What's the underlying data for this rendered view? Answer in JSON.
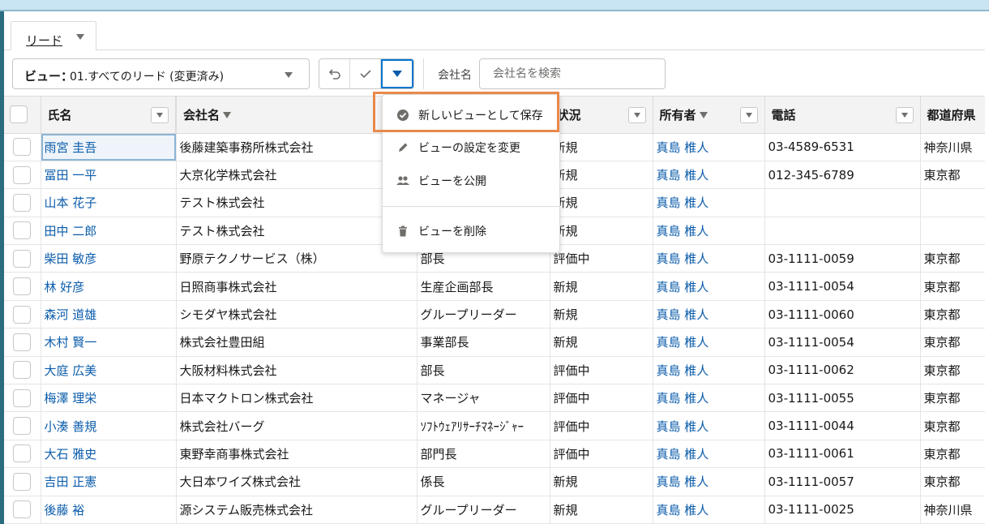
{
  "tab": {
    "label": "リード"
  },
  "view": {
    "prefix": "ビュー：",
    "name": "01.すべてのリード (変更済み)"
  },
  "search": {
    "label": "会社名",
    "placeholder": "会社名を検索"
  },
  "columns": [
    "氏名",
    "会社名",
    "",
    "状況",
    "所有者",
    "電話",
    "都道府県"
  ],
  "dropdown": {
    "items": [
      {
        "label": "新しいビューとして保存",
        "icon": "check-circle-icon"
      },
      {
        "label": "ビューの設定を変更",
        "icon": "pencil-icon"
      },
      {
        "label": "ビューを公開",
        "icon": "people-icon"
      },
      {
        "label": "ビューを削除",
        "icon": "trash-icon"
      }
    ]
  },
  "rows": [
    {
      "name": "雨宮 圭吾",
      "company": "後藤建築事務所株式会社",
      "title": "",
      "status": "新規",
      "owner": "真島 椎人",
      "phone": "03-4589-6531",
      "pref": "神奈川県"
    },
    {
      "name": "冨田 一平",
      "company": "大京化学株式会社",
      "title": "",
      "status": "新規",
      "owner": "真島 椎人",
      "phone": "012-345-6789",
      "pref": "東京都"
    },
    {
      "name": "山本 花子",
      "company": "テスト株式会社",
      "title": "",
      "status": "新規",
      "owner": "真島 椎人",
      "phone": "",
      "pref": ""
    },
    {
      "name": "田中 二郎",
      "company": "テスト株式会社",
      "title": "",
      "status": "新規",
      "owner": "真島 椎人",
      "phone": "",
      "pref": ""
    },
    {
      "name": "柴田 敏彦",
      "company": "野原テクノサービス（株）",
      "title": "部長",
      "status": "評価中",
      "owner": "真島 椎人",
      "phone": "03-1111-0059",
      "pref": "東京都"
    },
    {
      "name": "林 好彦",
      "company": "日照商事株式会社",
      "title": "生産企画部長",
      "status": "新規",
      "owner": "真島 椎人",
      "phone": "03-1111-0054",
      "pref": "東京都"
    },
    {
      "name": "森河 道雄",
      "company": "シモダヤ株式会社",
      "title": "グループリーダー",
      "status": "新規",
      "owner": "真島 椎人",
      "phone": "03-1111-0060",
      "pref": "東京都"
    },
    {
      "name": "木村 賢一",
      "company": "株式会社豊田組",
      "title": "事業部長",
      "status": "新規",
      "owner": "真島 椎人",
      "phone": "03-1111-0054",
      "pref": "東京都"
    },
    {
      "name": "大庭 広美",
      "company": "大阪材料株式会社",
      "title": "部長",
      "status": "評価中",
      "owner": "真島 椎人",
      "phone": "03-1111-0062",
      "pref": "東京都"
    },
    {
      "name": "梅澤 理栄",
      "company": "日本マクトロン株式会社",
      "title": "マネージャ",
      "status": "評価中",
      "owner": "真島 椎人",
      "phone": "03-1111-0055",
      "pref": "東京都"
    },
    {
      "name": "小湊 善規",
      "company": "株式会社バーグ",
      "title": "ｿﾌﾄｳｪｱﾘｻｰﾁﾏﾈｰｼﾞｬｰ",
      "status": "評価中",
      "owner": "真島 椎人",
      "phone": "03-1111-0044",
      "pref": "東京都"
    },
    {
      "name": "大石 雅史",
      "company": "東野幸商事株式会社",
      "title": "部門長",
      "status": "評価中",
      "owner": "真島 椎人",
      "phone": "03-1111-0061",
      "pref": "東京都"
    },
    {
      "name": "吉田 正憲",
      "company": "大日本ワイズ株式会社",
      "title": "係長",
      "status": "新規",
      "owner": "真島 椎人",
      "phone": "03-1111-0057",
      "pref": "東京都"
    },
    {
      "name": "後藤 裕",
      "company": "源システム販売株式会社",
      "title": "グループリーダー",
      "status": "新規",
      "owner": "真島 椎人",
      "phone": "03-1111-0025",
      "pref": "神奈川県"
    }
  ]
}
